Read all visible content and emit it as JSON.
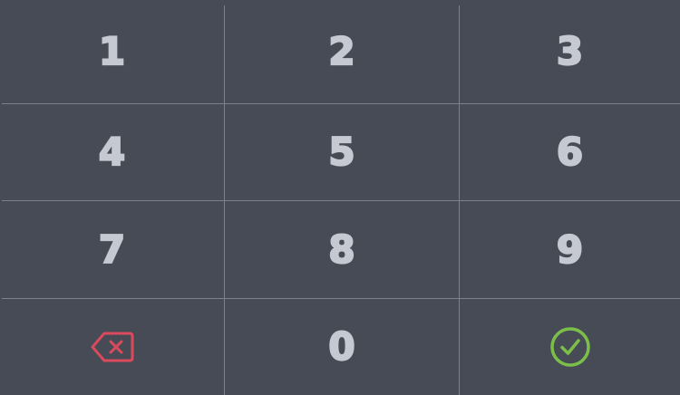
{
  "keypad": {
    "keys": [
      {
        "label": "1"
      },
      {
        "label": "2"
      },
      {
        "label": "3"
      },
      {
        "label": "4"
      },
      {
        "label": "5"
      },
      {
        "label": "6"
      },
      {
        "label": "7"
      },
      {
        "label": "8"
      },
      {
        "label": "9"
      },
      {
        "icon": "backspace-icon",
        "color": "#d94a5d"
      },
      {
        "label": "0"
      },
      {
        "icon": "check-circle-icon",
        "color": "#7bbf4a"
      }
    ],
    "colors": {
      "background": "#464b55",
      "divider": "#7c818b",
      "digit": "#c6c9d1"
    }
  }
}
